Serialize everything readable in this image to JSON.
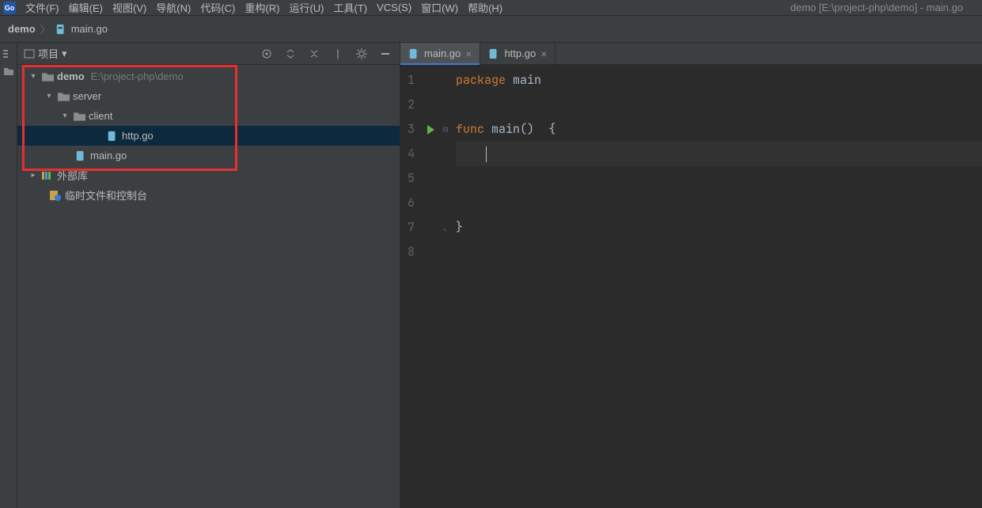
{
  "menu": {
    "items": [
      "文件(F)",
      "编辑(E)",
      "视图(V)",
      "导航(N)",
      "代码(C)",
      "重构(R)",
      "运行(U)",
      "工具(T)",
      "VCS(S)",
      "窗口(W)",
      "帮助(H)"
    ]
  },
  "window_title": "demo [E:\\project-php\\demo] - main.go",
  "breadcrumb": {
    "project": "demo",
    "file": "main.go"
  },
  "sidebar": {
    "title": "项目",
    "tree": {
      "root": {
        "name": "demo",
        "hint": "E:\\project-php\\demo"
      },
      "server": "server",
      "client": "client",
      "http_go": "http.go",
      "main_go": "main.go",
      "ext_libs": "外部库",
      "scratch": "临时文件和控制台"
    }
  },
  "tabs": [
    {
      "label": "main.go",
      "active": true
    },
    {
      "label": "http.go",
      "active": false
    }
  ],
  "code": {
    "line1_kw": "package",
    "line1_ident": "main",
    "line3_kw": "func",
    "line3_ident": "main",
    "line3_rest": "()  {",
    "line7_brace": "}"
  },
  "line_numbers": [
    "1",
    "2",
    "3",
    "4",
    "5",
    "6",
    "7",
    "8"
  ]
}
